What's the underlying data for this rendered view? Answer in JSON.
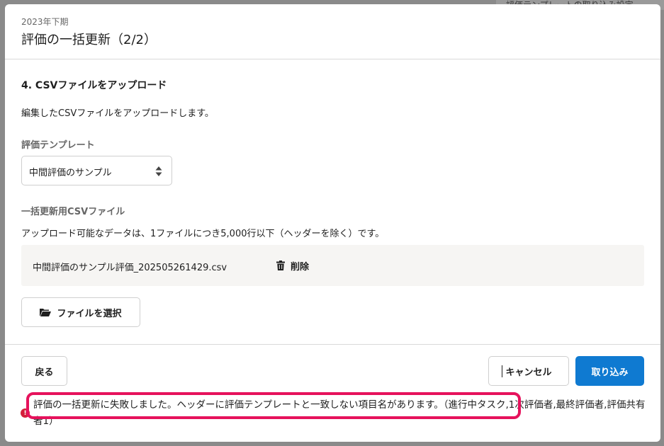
{
  "background": {
    "peek_text": "評価テンプレートの取り込み設定"
  },
  "modal": {
    "period": "2023年下期",
    "title": "評価の一括更新（2/2）"
  },
  "section": {
    "heading": "4. CSVファイルをアップロード",
    "description": "編集したCSVファイルをアップロードします。"
  },
  "template_field": {
    "label": "評価テンプレート",
    "selected": "中間評価のサンプル"
  },
  "csv_field": {
    "label": "一括更新用CSVファイル",
    "note": "アップロード可能なデータは、1ファイルにつき5,000行以下（ヘッダーを除く）です。",
    "file_name": "中間評価のサンプル評価_202505261429.csv",
    "delete_label": "削除",
    "select_file_label": "ファイルを選択"
  },
  "footer": {
    "back_label": "戻る",
    "cancel_label": "キャンセル",
    "import_label": "取り込み"
  },
  "error": {
    "icon": "!",
    "message": "評価の一括更新に失敗しました。ヘッダーに評価テンプレートと一致しない項目名があります。（進行中タスク,1次評価者,最終評価者,評価共有者1）"
  },
  "colors": {
    "primary": "#0f7ad1",
    "error": "#d31f3a",
    "highlight": "#e6125c"
  },
  "icons": {
    "select": "up-down-arrows-icon",
    "delete": "trash-icon",
    "select_file": "folder-open-icon",
    "error": "error-circle-icon"
  }
}
